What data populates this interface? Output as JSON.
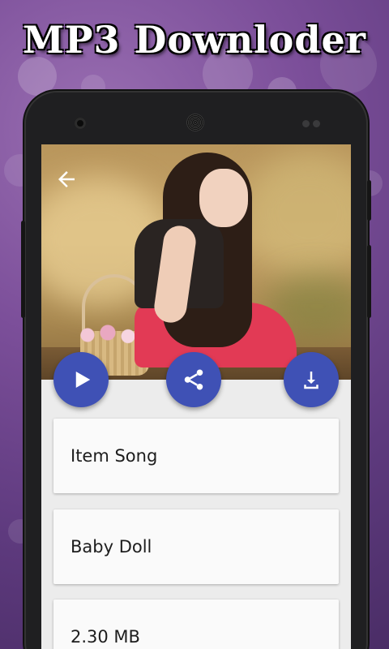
{
  "promo": {
    "title": "MP3 Downloder"
  },
  "toolbar": {
    "back_icon": "arrow-left-icon"
  },
  "actions": {
    "play_icon": "play-icon",
    "share_icon": "share-icon",
    "download_icon": "download-icon",
    "accent_color": "#3f51b5"
  },
  "details": {
    "items": [
      {
        "text": "Item Song"
      },
      {
        "text": "Baby Doll"
      },
      {
        "text": "2.30 MB"
      }
    ]
  }
}
